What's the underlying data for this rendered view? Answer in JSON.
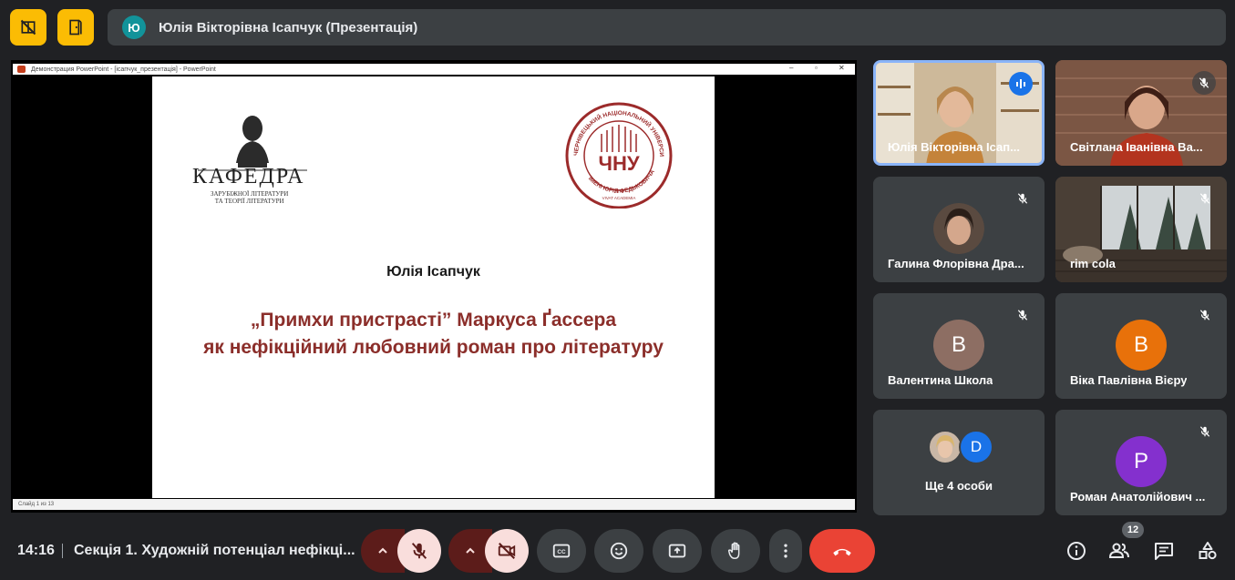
{
  "header": {
    "presenter_initial": "Ю",
    "presentation_title": "Юлія Вікторівна Ісапчук (Презентація)"
  },
  "powerpoint": {
    "window_title": "Демонстрация PowerPoint - [ісапчук_презентація] - PowerPoint",
    "status": "Слайд 1 из 13"
  },
  "slide": {
    "kafedra_word": "КАФЕДРА",
    "kafedra_sub_1": "ЗАРУБІЖНОЇ ЛІТЕРАТУРИ",
    "kafedra_sub_2": "ТА ТЕОРІЇ ЛІТЕРАТУРИ",
    "seal_top": "ЧЕРНІВЕЦЬКИЙ НАЦІОНАЛЬНИЙ УНІВЕРСИТЕТ",
    "seal_bottom": "ІМЕНІ ЮРІЯ ФЕДЬКОВИЧА",
    "seal_year": "1875",
    "seal_motto": "VIVAT ACADEMIA",
    "seal_center": "ЧНУ",
    "author": "Юлія Ісапчук",
    "title_line1": "„Примхи пристрасті” Маркуса Ґассера",
    "title_line2": "як нефікційний любовний роман про літературу"
  },
  "participants": [
    {
      "name": "Юлія Вікторівна Ісап...",
      "speaking": true
    },
    {
      "name": "Світлана Іванівна Ва...",
      "muted": true
    },
    {
      "name": "Галина Флорівна Дра...",
      "muted": true
    },
    {
      "name": "rim cola",
      "muted": true
    },
    {
      "name": "Валентина Школа",
      "initial": "В",
      "color": "#8d6e63",
      "muted": true
    },
    {
      "name": "Віка Павлівна Вієру",
      "initial": "В",
      "color": "#e8710a",
      "muted": true
    },
    {
      "name": "Ще 4 особи",
      "initial": "D",
      "color": "#1a73e8"
    },
    {
      "name": "Роман Анатолійович ...",
      "initial": "Р",
      "color": "#8430ce",
      "muted": true
    }
  ],
  "bottom": {
    "time": "14:16",
    "meeting_title": "Секція 1. Художній потенціал нефікці...",
    "people_count": "12"
  },
  "colors": {
    "accent_yellow": "#fbbc04",
    "end_call": "#ea4335",
    "active_speaker": "#8ab4f8",
    "slide_title": "#8b2e2a"
  }
}
